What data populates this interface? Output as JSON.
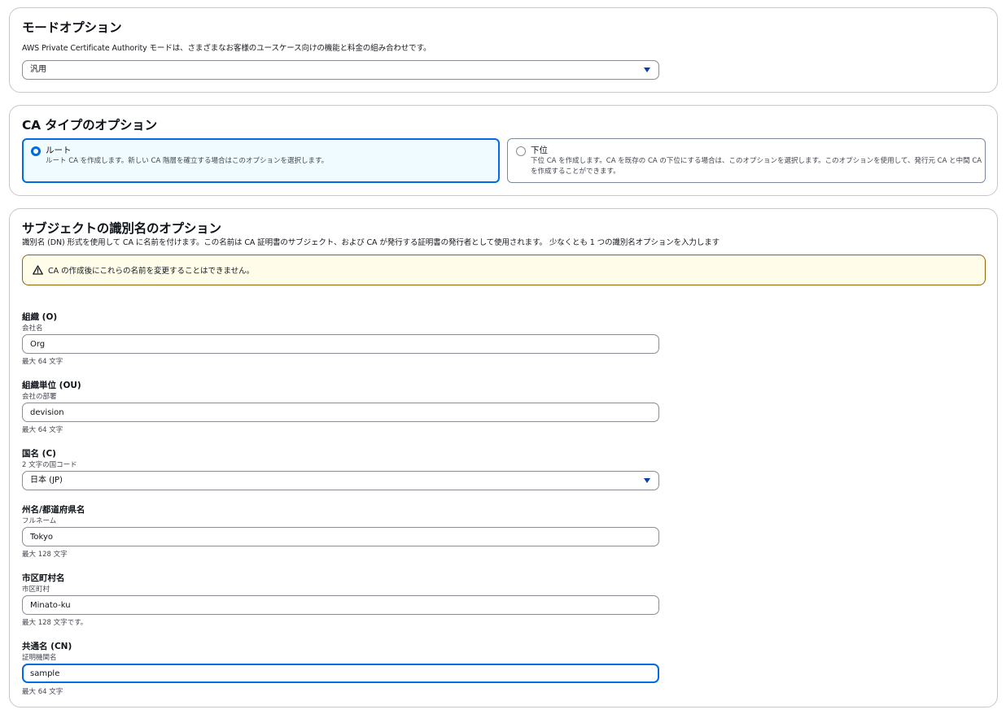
{
  "mode": {
    "title": "モードオプション",
    "description": "AWS Private Certificate Authority モードは、さまざまなお客様のユースケース向けの機能と料金の組み合わせです。",
    "selected": "汎用"
  },
  "ca_type": {
    "title": "CA タイプのオプション",
    "options": [
      {
        "label": "ルート",
        "description": "ルート CA を作成します。新しい CA 階層を確立する場合はこのオプションを選択します。",
        "selected": true
      },
      {
        "label": "下位",
        "description": "下位 CA を作成します。CA を既存の CA の下位にする場合は、このオプションを選択します。このオプションを使用して、発行元 CA と中間 CA を作成することができます。",
        "selected": false
      }
    ]
  },
  "subject": {
    "title": "サブジェクトの識別名のオプション",
    "description": "識別名 (DN) 形式を使用して CA に名前を付けます。この名前は CA 証明書のサブジェクト、および CA が発行する証明書の発行者として使用されます。 少なくとも 1 つの識別名オプションを入力します",
    "warning": "CA の作成後にこれらの名前を変更することはできません。",
    "fields": {
      "org": {
        "label": "組織 (O)",
        "sublabel": "会社名",
        "value": "Org",
        "hint": "最大 64 文字"
      },
      "ou": {
        "label": "組織単位 (OU)",
        "sublabel": "会社の部署",
        "value": "devision",
        "hint": "最大 64 文字"
      },
      "country": {
        "label": "国名 (C)",
        "sublabel": "2 文字の国コード",
        "value": "日本 (JP)"
      },
      "state": {
        "label": "州名/都道府県名",
        "sublabel": "フルネーム",
        "value": "Tokyo",
        "hint": "最大 128 文字"
      },
      "locality": {
        "label": "市区町村名",
        "sublabel": "市区町村",
        "value": "Minato-ku",
        "hint": "最大 128 文字です。"
      },
      "cn": {
        "label": "共通名 (CN)",
        "sublabel": "証明機関名",
        "value": "sample",
        "hint": "最大 64 文字"
      }
    }
  },
  "colors": {
    "accent": "#006ce0",
    "warning_border": "#8d6605",
    "warning_bg": "#fffce9"
  }
}
